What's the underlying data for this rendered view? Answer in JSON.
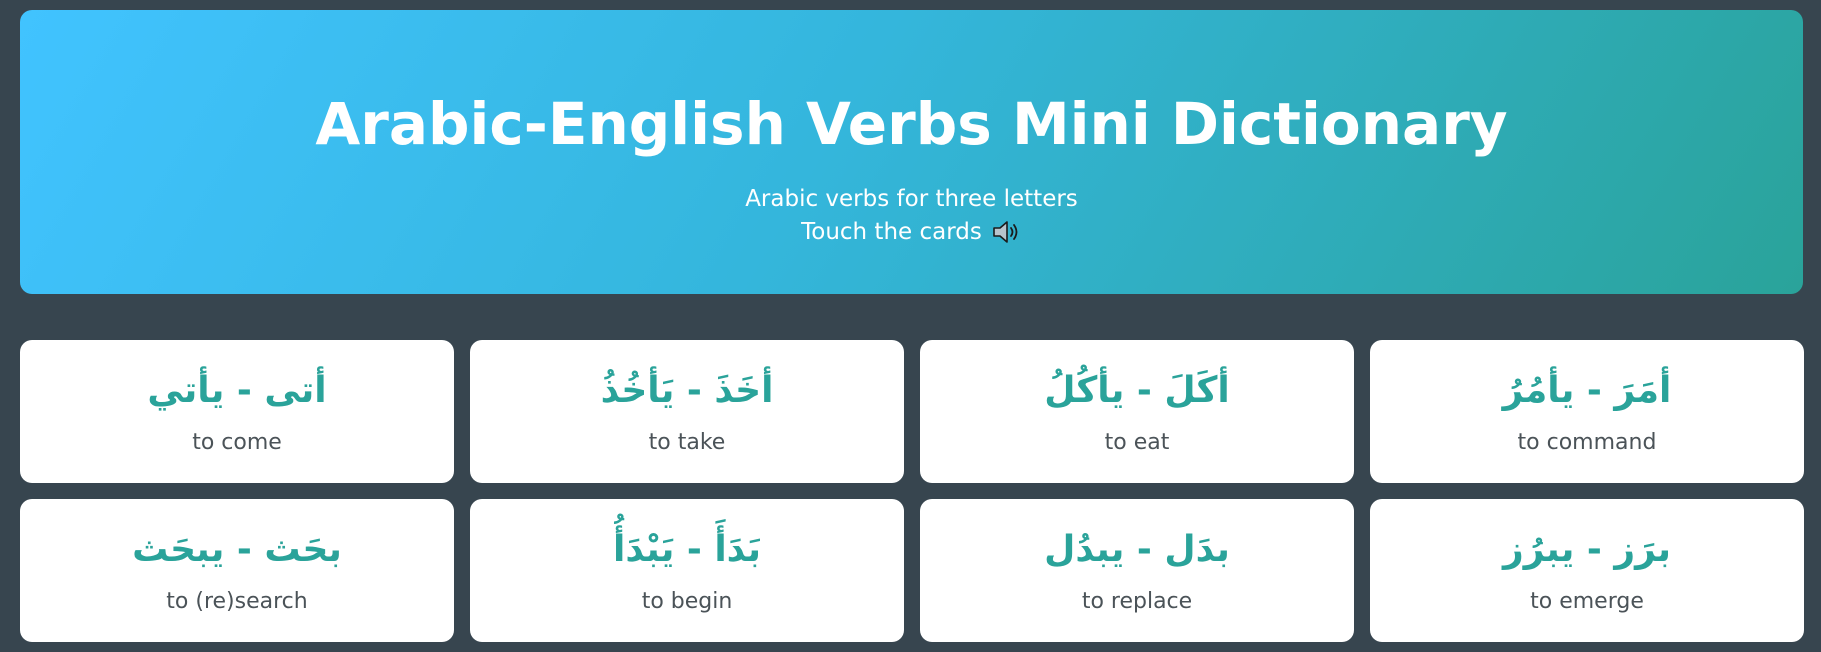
{
  "header": {
    "title": "Arabic-English Verbs Mini Dictionary",
    "subtitle": "Arabic verbs for three letters",
    "instruction": "Touch the cards",
    "icon": "speaker-icon"
  },
  "cards": [
    {
      "arabic": "أتى - يأتي",
      "english": "to come"
    },
    {
      "arabic": "أخَذَ - يَأخُذُ",
      "english": "to take"
    },
    {
      "arabic": "أكَلَ - يأكُلُ",
      "english": "to eat"
    },
    {
      "arabic": "أمَرَ - يأمُرُ",
      "english": "to command"
    },
    {
      "arabic": "بحَث - يبحَث",
      "english": "to (re)search"
    },
    {
      "arabic": "بَدَأَ - يَبْدَأُ",
      "english": "to begin"
    },
    {
      "arabic": "بدَل - يبدُل",
      "english": "to replace"
    },
    {
      "arabic": "برَز - يبرُز",
      "english": "to emerge"
    }
  ],
  "colors": {
    "background": "#37454f",
    "accent": "#2aa39a",
    "gradient_start": "#41c3ff",
    "gradient_end": "#2aa39a",
    "card_text": "#4b5358"
  }
}
